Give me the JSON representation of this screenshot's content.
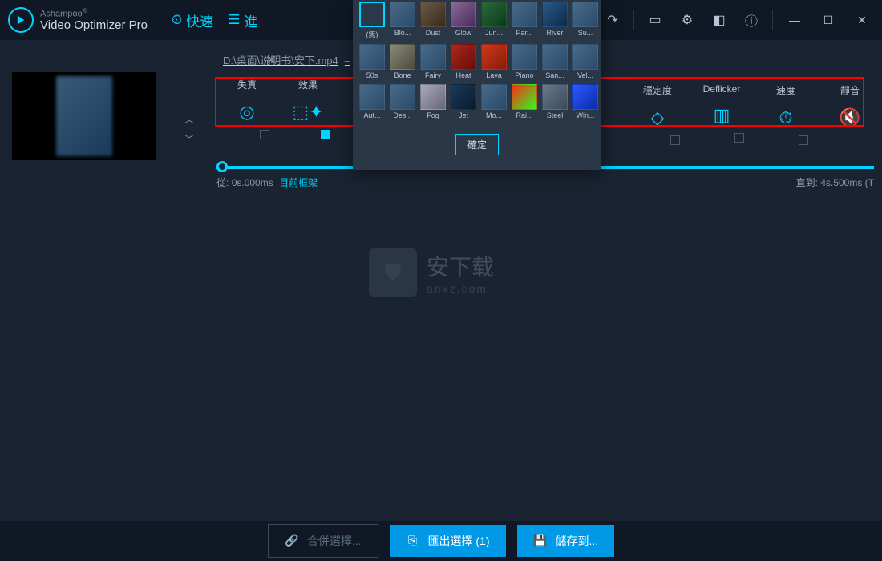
{
  "app": {
    "brand_top": "Ashampoo",
    "brand_bottom": "Video Optimizer Pro",
    "registered": "®"
  },
  "header": {
    "quick": "快速",
    "advanced": "進"
  },
  "file": {
    "path": "D:\\桌面\\说明书\\安下.mp4",
    "dash": "–"
  },
  "tools": {
    "distortion": "失真",
    "effects": "效果",
    "stability": "穩定度",
    "deflicker": "Deflicker",
    "speed": "速度",
    "mute": "靜音"
  },
  "timeline": {
    "from_label": "從:",
    "from_time": "0s.000ms",
    "current_frame": "目前框架",
    "to_label": "直到:",
    "to_time": "4s.500ms (T"
  },
  "effects_panel": {
    "confirm": "確定",
    "rows": [
      [
        "(無)",
        "Blo...",
        "Dust",
        "Glow",
        "Jun...",
        "Par...",
        "River",
        "Su..."
      ],
      [
        "50s",
        "Bone",
        "Fairy",
        "Heat",
        "Lava",
        "Piano",
        "San...",
        "Vel..."
      ],
      [
        "Aut...",
        "Des...",
        "Fog",
        "Jet",
        "Mo...",
        "Rai...",
        "Steel",
        "Win..."
      ]
    ]
  },
  "watermark": {
    "text": "安下载",
    "url": "anxz.com"
  },
  "footer": {
    "merge": "合併選擇...",
    "export": "匯出選擇 (1)",
    "save": "儲存到..."
  }
}
